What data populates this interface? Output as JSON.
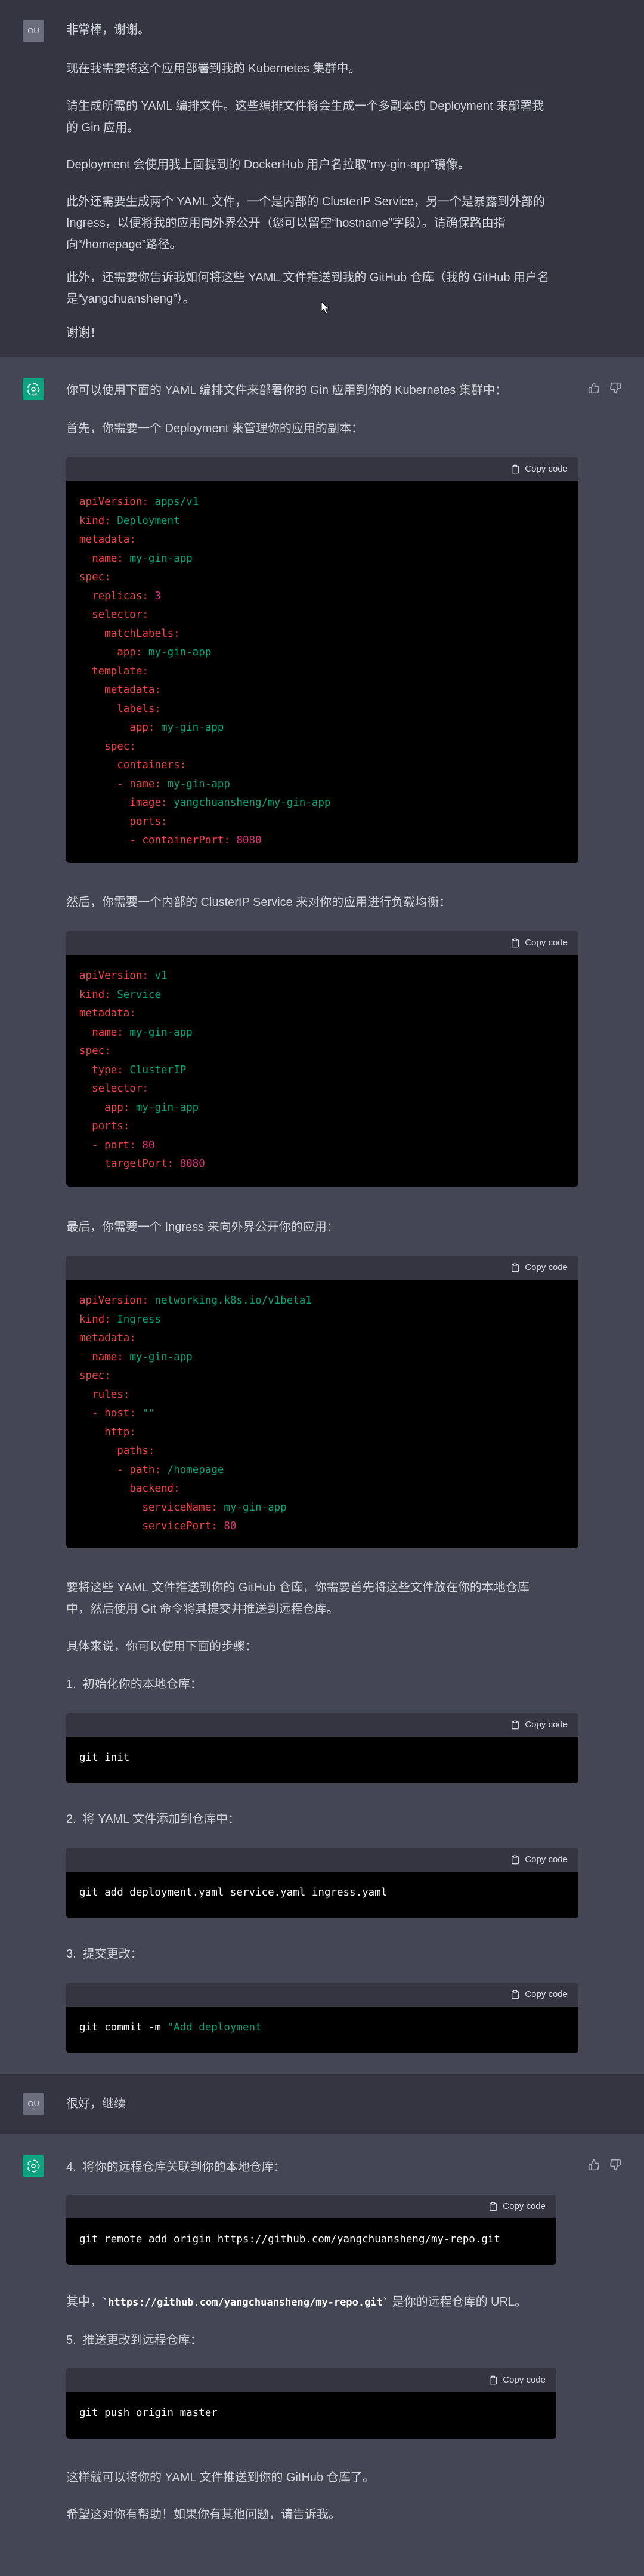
{
  "user1": {
    "avatar": "OU",
    "lines": [
      "非常棒，谢谢。",
      "现在我需要将这个应用部署到我的 Kubernetes 集群中。",
      "请生成所需的 YAML 编排文件。这些编排文件将会生成一个多副本的 Deployment 来部署我\n的 Gin 应用。",
      "Deployment 会使用我上面提到的 DockerHub 用户名拉取“my-gin-app”镜像。",
      "此外还需要生成两个 YAML 文件，一个是内部的 ClusterIP Service，另一个是暴露到外部的\nIngress，以便将我的应用向外界公开（您可以留空“hostname”字段）。请确保路由指\n向“/homepage”路径。",
      "此外，还需要你告诉我如何将这些 YAML 文件推送到我的 GitHub 仓库（我的 GitHub 用户名\n是“yangchuansheng”）。",
      "谢谢！"
    ]
  },
  "assistant1": {
    "intro": "你可以使用下面的 YAML 编排文件来部署你的 Gin 应用到你的 Kubernetes 集群中：",
    "p_deploy": "首先，你需要一个 Deployment 来管理你的应用的副本：",
    "p_service": "然后，你需要一个内部的 ClusterIP Service 来对你的应用进行负载均衡：",
    "p_ingress": "最后，你需要一个 Ingress 来向外界公开你的应用：",
    "p_git1": "要将这些 YAML 文件推送到你的 GitHub 仓库，你需要首先将这些文件放在你的本地仓库\n中，然后使用 Git 命令将其提交并推送到远程仓库。",
    "p_git2": "具体来说，你可以使用下面的步骤：",
    "step1": "1.  初始化你的本地仓库：",
    "step2": "2.  将 YAML 文件添加到仓库中：",
    "step3": "3.  提交更改：",
    "cmd1": "git init",
    "cmd2": "git add deployment.yaml service.yaml ingress.yaml",
    "cmd3a": "git commit -m ",
    "cmd3b": "\"Add deployment"
  },
  "user2": {
    "avatar": "OU",
    "text": "很好，继续"
  },
  "assistant2": {
    "step4": "4.  将你的远程仓库关联到你的本地仓库：",
    "cmd4": "git remote add origin https://github.com/yangchuansheng/my-repo.git",
    "p_repo_a": "其中，",
    "p_repo_code": "`https://github.com/yangchuansheng/my-repo.git`",
    "p_repo_b": " 是你的远程仓库的 URL。",
    "step5": "5.  推送更改到远程仓库：",
    "cmd5": "git push origin master",
    "p_done": "这样就可以将你的 YAML 文件推送到你的 GitHub 仓库了。",
    "p_end": "希望这对你有帮助！如果你有其他问题，请告诉我。"
  },
  "copy_label": "Copy code",
  "colors": {
    "user_bg": "#343541",
    "assistant_bg": "#444654",
    "gpt_green": "#10a37f",
    "code_key": "#ef4146",
    "code_val": "#00a67d",
    "code_num": "#df3079"
  },
  "icons": [
    "openai-logo-icon",
    "clipboard-icon",
    "thumbs-up-icon",
    "thumbs-down-icon",
    "mouse-cursor-icon"
  ]
}
